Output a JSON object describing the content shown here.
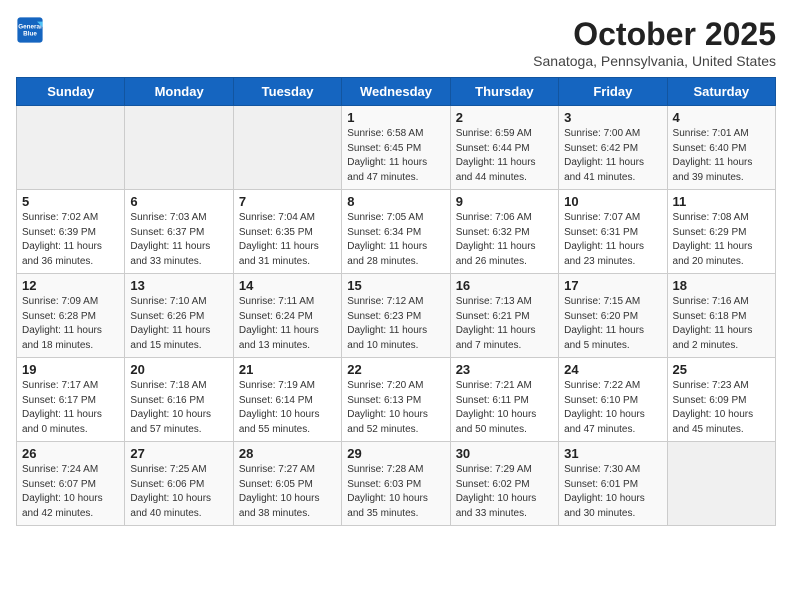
{
  "logo": {
    "line1": "General",
    "line2": "Blue"
  },
  "title": "October 2025",
  "subtitle": "Sanatoga, Pennsylvania, United States",
  "days_of_week": [
    "Sunday",
    "Monday",
    "Tuesday",
    "Wednesday",
    "Thursday",
    "Friday",
    "Saturday"
  ],
  "weeks": [
    [
      {
        "day": "",
        "info": ""
      },
      {
        "day": "",
        "info": ""
      },
      {
        "day": "",
        "info": ""
      },
      {
        "day": "1",
        "info": "Sunrise: 6:58 AM\nSunset: 6:45 PM\nDaylight: 11 hours and 47 minutes."
      },
      {
        "day": "2",
        "info": "Sunrise: 6:59 AM\nSunset: 6:44 PM\nDaylight: 11 hours and 44 minutes."
      },
      {
        "day": "3",
        "info": "Sunrise: 7:00 AM\nSunset: 6:42 PM\nDaylight: 11 hours and 41 minutes."
      },
      {
        "day": "4",
        "info": "Sunrise: 7:01 AM\nSunset: 6:40 PM\nDaylight: 11 hours and 39 minutes."
      }
    ],
    [
      {
        "day": "5",
        "info": "Sunrise: 7:02 AM\nSunset: 6:39 PM\nDaylight: 11 hours and 36 minutes."
      },
      {
        "day": "6",
        "info": "Sunrise: 7:03 AM\nSunset: 6:37 PM\nDaylight: 11 hours and 33 minutes."
      },
      {
        "day": "7",
        "info": "Sunrise: 7:04 AM\nSunset: 6:35 PM\nDaylight: 11 hours and 31 minutes."
      },
      {
        "day": "8",
        "info": "Sunrise: 7:05 AM\nSunset: 6:34 PM\nDaylight: 11 hours and 28 minutes."
      },
      {
        "day": "9",
        "info": "Sunrise: 7:06 AM\nSunset: 6:32 PM\nDaylight: 11 hours and 26 minutes."
      },
      {
        "day": "10",
        "info": "Sunrise: 7:07 AM\nSunset: 6:31 PM\nDaylight: 11 hours and 23 minutes."
      },
      {
        "day": "11",
        "info": "Sunrise: 7:08 AM\nSunset: 6:29 PM\nDaylight: 11 hours and 20 minutes."
      }
    ],
    [
      {
        "day": "12",
        "info": "Sunrise: 7:09 AM\nSunset: 6:28 PM\nDaylight: 11 hours and 18 minutes."
      },
      {
        "day": "13",
        "info": "Sunrise: 7:10 AM\nSunset: 6:26 PM\nDaylight: 11 hours and 15 minutes."
      },
      {
        "day": "14",
        "info": "Sunrise: 7:11 AM\nSunset: 6:24 PM\nDaylight: 11 hours and 13 minutes."
      },
      {
        "day": "15",
        "info": "Sunrise: 7:12 AM\nSunset: 6:23 PM\nDaylight: 11 hours and 10 minutes."
      },
      {
        "day": "16",
        "info": "Sunrise: 7:13 AM\nSunset: 6:21 PM\nDaylight: 11 hours and 7 minutes."
      },
      {
        "day": "17",
        "info": "Sunrise: 7:15 AM\nSunset: 6:20 PM\nDaylight: 11 hours and 5 minutes."
      },
      {
        "day": "18",
        "info": "Sunrise: 7:16 AM\nSunset: 6:18 PM\nDaylight: 11 hours and 2 minutes."
      }
    ],
    [
      {
        "day": "19",
        "info": "Sunrise: 7:17 AM\nSunset: 6:17 PM\nDaylight: 11 hours and 0 minutes."
      },
      {
        "day": "20",
        "info": "Sunrise: 7:18 AM\nSunset: 6:16 PM\nDaylight: 10 hours and 57 minutes."
      },
      {
        "day": "21",
        "info": "Sunrise: 7:19 AM\nSunset: 6:14 PM\nDaylight: 10 hours and 55 minutes."
      },
      {
        "day": "22",
        "info": "Sunrise: 7:20 AM\nSunset: 6:13 PM\nDaylight: 10 hours and 52 minutes."
      },
      {
        "day": "23",
        "info": "Sunrise: 7:21 AM\nSunset: 6:11 PM\nDaylight: 10 hours and 50 minutes."
      },
      {
        "day": "24",
        "info": "Sunrise: 7:22 AM\nSunset: 6:10 PM\nDaylight: 10 hours and 47 minutes."
      },
      {
        "day": "25",
        "info": "Sunrise: 7:23 AM\nSunset: 6:09 PM\nDaylight: 10 hours and 45 minutes."
      }
    ],
    [
      {
        "day": "26",
        "info": "Sunrise: 7:24 AM\nSunset: 6:07 PM\nDaylight: 10 hours and 42 minutes."
      },
      {
        "day": "27",
        "info": "Sunrise: 7:25 AM\nSunset: 6:06 PM\nDaylight: 10 hours and 40 minutes."
      },
      {
        "day": "28",
        "info": "Sunrise: 7:27 AM\nSunset: 6:05 PM\nDaylight: 10 hours and 38 minutes."
      },
      {
        "day": "29",
        "info": "Sunrise: 7:28 AM\nSunset: 6:03 PM\nDaylight: 10 hours and 35 minutes."
      },
      {
        "day": "30",
        "info": "Sunrise: 7:29 AM\nSunset: 6:02 PM\nDaylight: 10 hours and 33 minutes."
      },
      {
        "day": "31",
        "info": "Sunrise: 7:30 AM\nSunset: 6:01 PM\nDaylight: 10 hours and 30 minutes."
      },
      {
        "day": "",
        "info": ""
      }
    ]
  ]
}
